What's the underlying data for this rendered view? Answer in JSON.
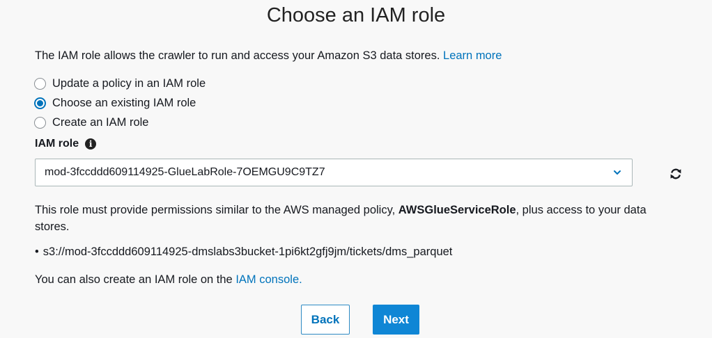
{
  "header": {
    "title": "Choose an IAM role"
  },
  "description": {
    "text": "The IAM role allows the crawler to run and access your Amazon S3 data stores. ",
    "learn_more": "Learn more"
  },
  "options": [
    {
      "label": "Update a policy in an IAM role",
      "selected": false
    },
    {
      "label": "Choose an existing IAM role",
      "selected": true
    },
    {
      "label": "Create an IAM role",
      "selected": false
    }
  ],
  "iam_role": {
    "label": "IAM role",
    "info_icon": "info-icon",
    "value": "mod-3fccddd609114925-GlueLabRole-7OEMGU9C9TZ7",
    "dropdown_icon": "chevron-down-icon",
    "refresh_icon": "refresh-icon"
  },
  "permissions": {
    "before": "This role must provide permissions similar to the AWS managed policy, ",
    "policy": "AWSGlueServiceRole",
    "after": ", plus access to your data stores."
  },
  "data_stores": [
    "s3://mod-3fccddd609114925-dmslabs3bucket-1pi6kt2gfj9jm/tickets/dms_parquet"
  ],
  "console": {
    "text": "You can also create an IAM role on the ",
    "link": "IAM console."
  },
  "buttons": {
    "back": "Back",
    "next": "Next"
  },
  "colors": {
    "accent": "#0073bb",
    "primary_button": "#0f86d5",
    "background": "#f8f8f8"
  }
}
